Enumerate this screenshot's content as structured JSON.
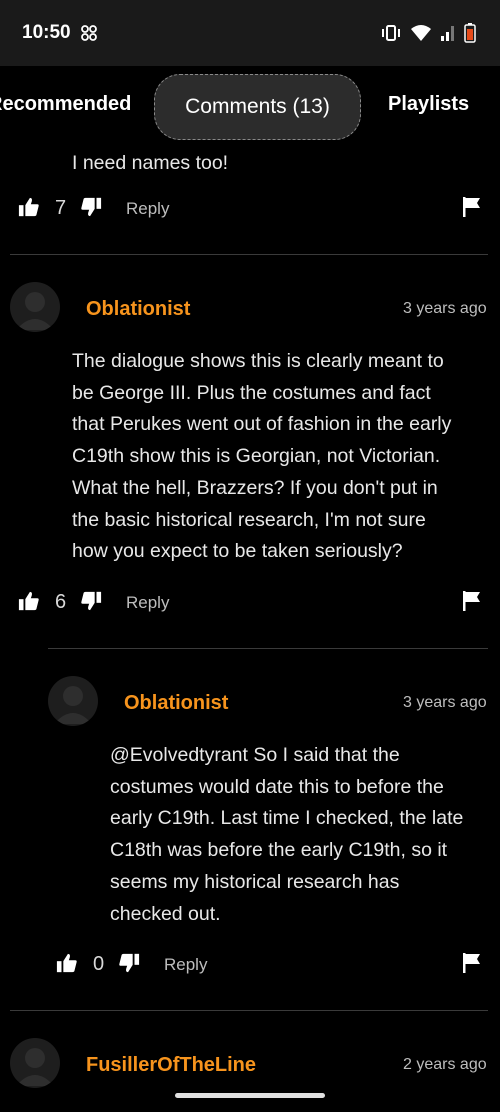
{
  "status": {
    "time": "10:50"
  },
  "tabs": [
    {
      "label": "Recommended"
    },
    {
      "label": "Comments (13)"
    },
    {
      "label": "Playlists"
    }
  ],
  "comments": [
    {
      "text": "I need names too!",
      "likes": "7",
      "reply_label": "Reply"
    },
    {
      "username": "Oblationist",
      "time": "3 years ago",
      "text_lines": [
        "The dialogue shows this is clearly meant to",
        "be George III. Plus the costumes and fact",
        "that Perukes went out of fashion in the early",
        "C19th show this is Georgian, not Victorian.",
        "What the hell, Brazzers? If you don't put in",
        "the basic historical research, I'm not sure",
        "how you expect to be taken seriously?"
      ],
      "likes": "6",
      "reply_label": "Reply"
    },
    {
      "username": "Oblationist",
      "time": "3 years ago",
      "text_lines": [
        "@Evolvedtyrant So I said that the",
        "costumes would date this to before the",
        "early C19th. Last time I checked, the late",
        "C18th was before the early C19th, so it",
        "seems my historical research has",
        "checked out."
      ],
      "likes": "0",
      "reply_label": "Reply"
    },
    {
      "username": "FusillerOfTheLine",
      "time": "2 years ago"
    }
  ],
  "colors": {
    "accent": "#f7941d",
    "background": "#000000",
    "statusbar": "#1a1a1a"
  }
}
